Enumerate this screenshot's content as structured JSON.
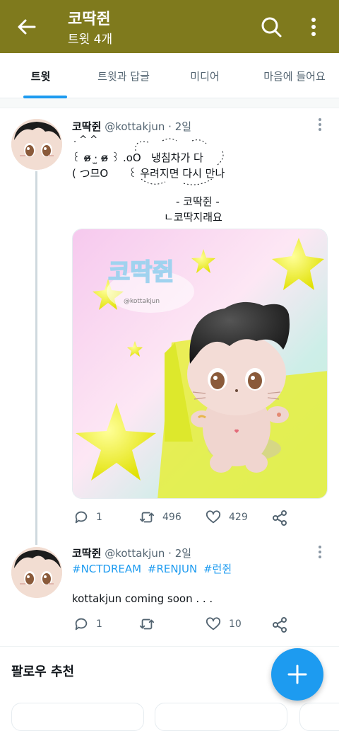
{
  "header": {
    "title": "코딱쥔",
    "subtitle": "트윗 4개",
    "bar_color": "#7f7a1d"
  },
  "tabs": [
    {
      "label": "트윗",
      "active": true
    },
    {
      "label": "트윗과 답글",
      "active": false
    },
    {
      "label": "미디어",
      "active": false
    },
    {
      "label": "마음에 들어요",
      "active": false
    }
  ],
  "tweets": [
    {
      "name": "코딱쥔",
      "handle": "@kottakjun",
      "separator": "·",
      "time": "2일",
      "lines": [
        ". ^ ^",
        "꒰ ɞ̴̶̷ ·̫ ɞ̴̶̷ ꒱ .oO   냉침차가 다",
        "( つ므O      ꒰ 우려지면 다시 만나",
        "- 코딱쥔 -",
        "ㄴ코딱지래요"
      ],
      "media": {
        "sign_text": "코딱쥔",
        "sign_sub": "@kottakjun"
      },
      "actions": {
        "reply": "1",
        "retweet": "496",
        "like": "429"
      }
    },
    {
      "name": "코딱쥔",
      "handle": "@kottakjun",
      "separator": "·",
      "time": "2일",
      "hashtags": [
        "#NCTDREAM",
        "#RENJUN",
        "#런쥔"
      ],
      "text": "kottakjun coming soon . . .",
      "actions": {
        "reply": "1",
        "retweet": "",
        "like": "10"
      }
    }
  ],
  "follow": {
    "title": "팔로우 추천"
  },
  "colors": {
    "accent": "#1d9bf0",
    "muted": "#536471"
  },
  "icons": {
    "back": "arrow-left-icon",
    "search": "search-icon",
    "more": "more-vertical-icon",
    "reply": "reply-icon",
    "retweet": "retweet-icon",
    "like": "heart-icon",
    "share": "share-icon",
    "compose": "plus-icon"
  }
}
